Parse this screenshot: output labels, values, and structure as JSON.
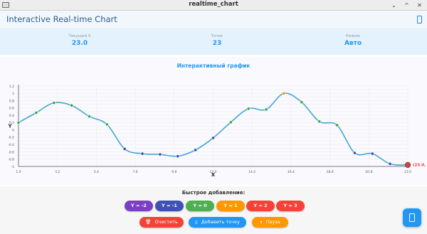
{
  "window": {
    "title": "realtime_chart",
    "minimize_glyph": "⌄",
    "maximize_glyph": "^",
    "close_glyph": "✕"
  },
  "appbar": {
    "title": "Interactive Real-time Chart"
  },
  "stats": [
    {
      "label": "Текущий X",
      "value": "23.0"
    },
    {
      "label": "Точек",
      "value": "23"
    },
    {
      "label": "Режим",
      "value": "Авто"
    }
  ],
  "chart_data": {
    "type": "line",
    "title": "Интерактивный график",
    "xlabel": "X",
    "ylabel": "Y",
    "xlim": [
      1.0,
      23.0
    ],
    "ylim": [
      -1.0,
      1.2
    ],
    "x_ticks": [
      1.0,
      3.2,
      5.4,
      7.6,
      9.8,
      12.0,
      14.2,
      16.4,
      18.6,
      20.8,
      23.0
    ],
    "x_tick_labels": [
      "1.0",
      "3.2",
      "5.4",
      "7.6",
      "9.8",
      "12.0",
      "14.2",
      "16.4",
      "18.6",
      "20.8",
      "23.0"
    ],
    "y_ticks": [
      1.2,
      1.0,
      0.8,
      0.6,
      0.4,
      0.2,
      0.0,
      -0.2,
      -0.4,
      -0.6,
      -0.8,
      -1.0
    ],
    "y_tick_labels": [
      "1.2",
      "1",
      "0.8",
      "0.6",
      "0.4",
      "0.2",
      "0",
      "-0.2",
      "-0.4",
      "-0.6",
      "-0.8",
      "-1"
    ],
    "grid": true,
    "series": [
      {
        "x": [
          1,
          2,
          3,
          4,
          5,
          6,
          7,
          8,
          9,
          10,
          11,
          12,
          13,
          14,
          15,
          16,
          17,
          18,
          19,
          20,
          21,
          22,
          23
        ],
        "y": [
          0.2,
          0.47,
          0.74,
          0.67,
          0.37,
          0.15,
          -0.52,
          -0.65,
          -0.67,
          -0.72,
          -0.55,
          -0.22,
          0.21,
          0.58,
          0.56,
          1.0,
          0.76,
          0.23,
          0.13,
          -0.63,
          -0.65,
          -0.93,
          -0.96
        ],
        "point_colors": [
          "#43a047",
          "#43a047",
          "#43a047",
          "#43a047",
          "#43a047",
          "#43a047",
          "#3949ab",
          "#3949ab",
          "#3949ab",
          "#3949ab",
          "#3949ab",
          "#3949ab",
          "#43a047",
          "#43a047",
          "#43a047",
          "#fb8c00",
          "#43a047",
          "#43a047",
          "#43a047",
          "#3949ab",
          "#3949ab",
          "#3949ab",
          "#e53935"
        ]
      }
    ],
    "annotation": "(23.0,",
    "line_color": "#42a5d6"
  },
  "quick_add": {
    "title": "Быстрое добавление:",
    "buttons": [
      {
        "label": "Y = -2",
        "color": "#7b3fc4"
      },
      {
        "label": "Y = -1",
        "color": "#3f51b5"
      },
      {
        "label": "Y = 0",
        "color": "#4caf50"
      },
      {
        "label": "Y = 1",
        "color": "#ff9800"
      },
      {
        "label": "Y = 2",
        "color": "#f44336"
      },
      {
        "label": "Y = 3",
        "color": "#f44336"
      }
    ]
  },
  "actions": [
    {
      "label": "Очистить",
      "icon": "trash-icon",
      "glyph": "🗑",
      "color": "#f44336"
    },
    {
      "label": "Добавить точку",
      "icon": "phone-icon",
      "glyph": "▯",
      "color": "#2196f3"
    },
    {
      "label": "Пауза",
      "icon": "pause-icon",
      "glyph": "⏸",
      "color": "#ff9800"
    }
  ]
}
